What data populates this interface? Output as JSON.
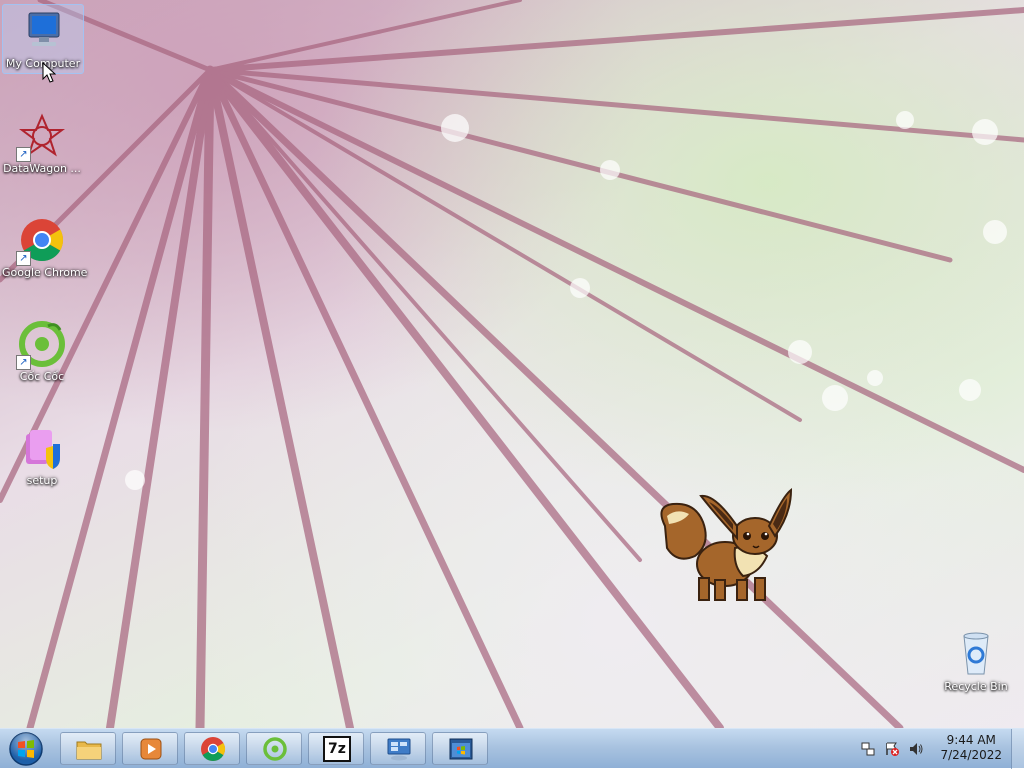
{
  "desktop": {
    "icons": [
      {
        "label": "My Computer",
        "icon": "computer-icon",
        "shortcut": false
      },
      {
        "label": "DataWagon ...",
        "icon": "datawagon-icon",
        "shortcut": true
      },
      {
        "label": "Google Chrome",
        "icon": "chrome-icon",
        "shortcut": true
      },
      {
        "label": "Cốc Cốc",
        "icon": "coccoc-icon",
        "shortcut": true
      },
      {
        "label": "setup",
        "icon": "setup-icon",
        "shortcut": false
      },
      {
        "label": "Recycle Bin",
        "icon": "recycle-bin-icon",
        "shortcut": false
      }
    ],
    "mascot": "eevee-sprite"
  },
  "taskbar": {
    "start": "start-button",
    "pinned": [
      {
        "name": "explorer",
        "icon": "folder-icon"
      },
      {
        "name": "media-player",
        "icon": "media-player-icon"
      },
      {
        "name": "chrome",
        "icon": "chrome-icon"
      },
      {
        "name": "coccoc",
        "icon": "coccoc-icon"
      },
      {
        "name": "7zip",
        "icon": "7zip-icon",
        "text": "7z"
      },
      {
        "name": "remote-desktop",
        "icon": "remote-desktop-icon"
      },
      {
        "name": "windows-app",
        "icon": "windows-window-icon"
      }
    ],
    "tray": {
      "icons": [
        "network-icon",
        "action-center-icon",
        "volume-icon"
      ],
      "time": "9:44 AM",
      "date": "7/24/2022"
    }
  },
  "colors": {
    "taskbar": "#a9c3e0",
    "selection": "#b4d7ff",
    "chrome_red": "#db4437",
    "chrome_yellow": "#f4c20d",
    "chrome_green": "#0f9d58",
    "chrome_blue": "#4285f4",
    "coccoc_green": "#6bbf3a"
  }
}
